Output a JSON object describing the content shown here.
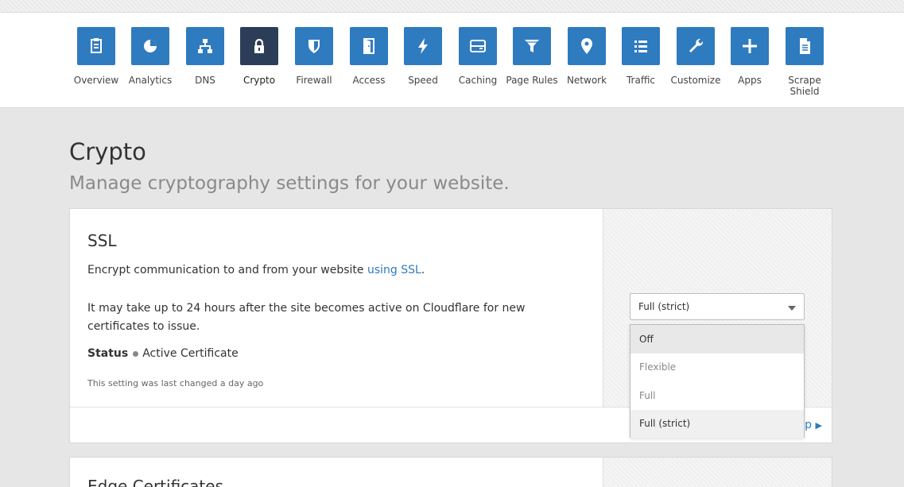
{
  "nav": {
    "items": [
      {
        "label": "Overview",
        "icon": "overview-icon"
      },
      {
        "label": "Analytics",
        "icon": "analytics-icon"
      },
      {
        "label": "DNS",
        "icon": "dns-icon"
      },
      {
        "label": "Crypto",
        "icon": "lock-icon",
        "active": true
      },
      {
        "label": "Firewall",
        "icon": "shield-icon"
      },
      {
        "label": "Access",
        "icon": "door-icon"
      },
      {
        "label": "Speed",
        "icon": "lightning-icon"
      },
      {
        "label": "Caching",
        "icon": "storage-icon"
      },
      {
        "label": "Page Rules",
        "icon": "filter-icon"
      },
      {
        "label": "Network",
        "icon": "location-pin-icon"
      },
      {
        "label": "Traffic",
        "icon": "list-icon"
      },
      {
        "label": "Customize",
        "icon": "wrench-icon"
      },
      {
        "label": "Apps",
        "icon": "plus-icon"
      },
      {
        "label": "Scrape Shield",
        "icon": "document-icon"
      }
    ]
  },
  "page": {
    "title": "Crypto",
    "subtitle": "Manage cryptography settings for your website."
  },
  "ssl": {
    "title": "SSL",
    "text1_prefix": "Encrypt communication to and from your website ",
    "text1_link": "using SSL",
    "text1_suffix": ".",
    "text2": "It may take up to 24 hours after the site becomes active on Cloudflare for new certificates to issue.",
    "status_label": "Status",
    "status_value": "Active Certificate",
    "changed_note": "This setting was last changed a day ago",
    "help_link": "lp",
    "select_value": "Full (strict)",
    "options": [
      "Off",
      "Flexible",
      "Full",
      "Full (strict)"
    ]
  },
  "edge": {
    "title": "Edge Certificates"
  },
  "colors": {
    "accent": "#2f7bbf",
    "active_nav": "#2c3e57"
  }
}
